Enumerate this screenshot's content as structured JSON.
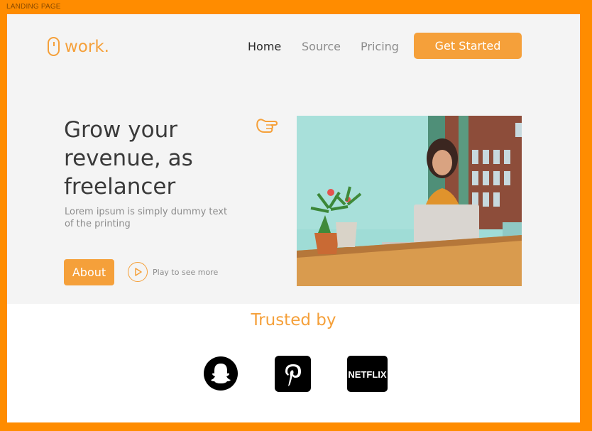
{
  "frame": {
    "label": "LANDING PAGE"
  },
  "header": {
    "logo_text": "work.",
    "nav": [
      {
        "label": "Home",
        "active": true
      },
      {
        "label": "Source",
        "active": false
      },
      {
        "label": "Pricing",
        "active": false
      }
    ],
    "cta_label": "Get Started"
  },
  "hero": {
    "headline_lines": [
      "Grow your",
      "revenue, as",
      "freelancer"
    ],
    "subtext": "Lorem ipsum is simply dummy text of the printing",
    "about_label": "About",
    "play_label": "Play to see more",
    "pointer_icon": "pointing-hand-icon",
    "image": "woman-at-laptop-photo"
  },
  "trusted": {
    "title": "Trusted by",
    "brands": [
      {
        "name": "snapchat",
        "icon": "snapchat-icon"
      },
      {
        "name": "pinterest",
        "icon": "pinterest-icon"
      },
      {
        "name": "netflix",
        "icon": "netflix-icon",
        "label": "NETFLIX"
      }
    ]
  },
  "colors": {
    "accent": "#f5a03a",
    "frame": "#ff8c00",
    "hero_bg": "#f4f4f4",
    "text_dark": "#3a3a3a",
    "text_muted": "#8c8c8c"
  }
}
